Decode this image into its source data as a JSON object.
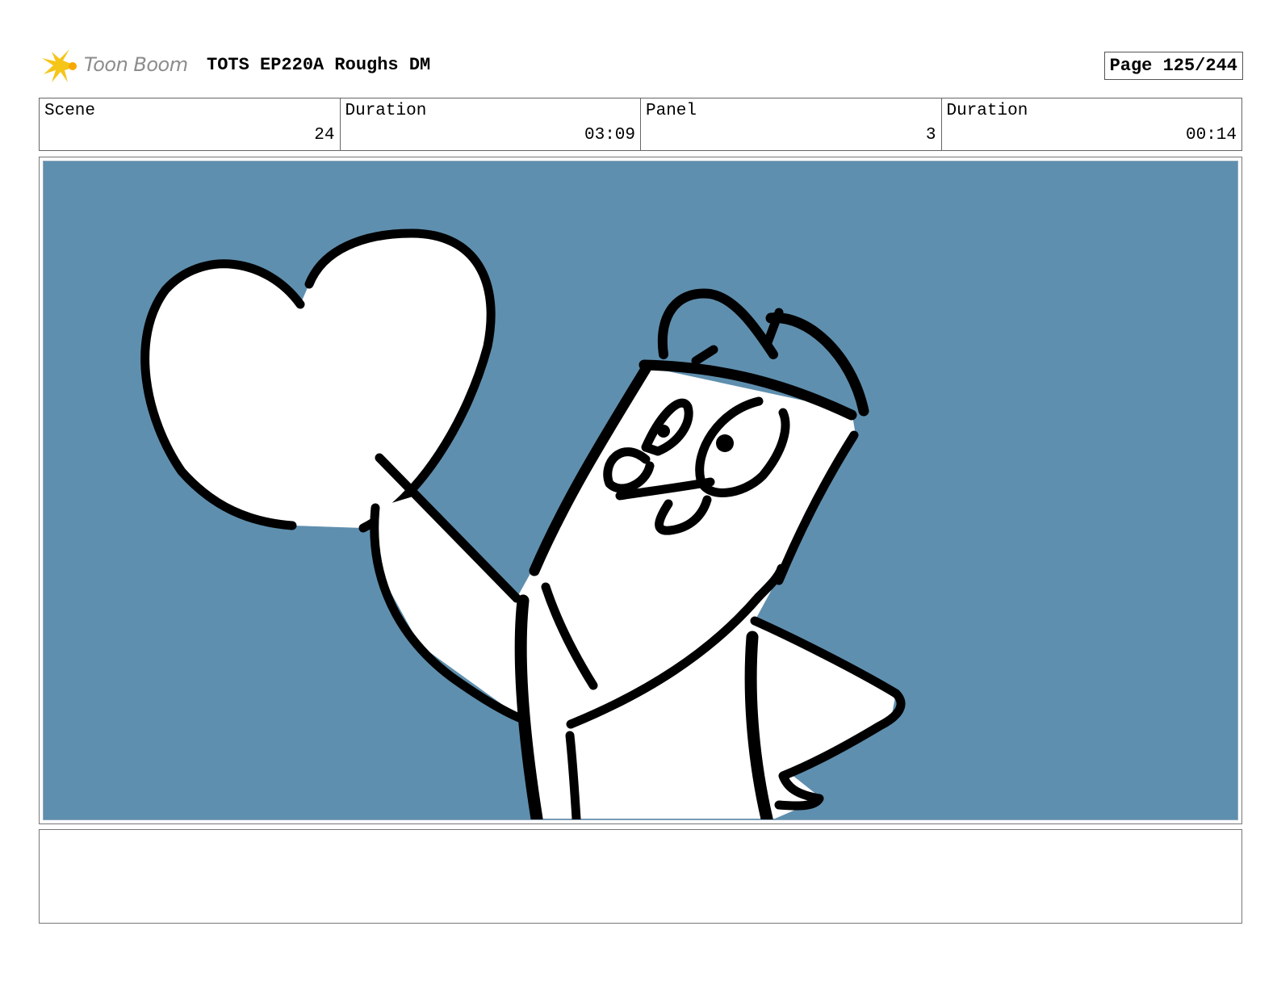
{
  "header": {
    "logo_text": "Toon Boom",
    "title": "TOTS EP220A Roughs DM",
    "page": "Page 125/244"
  },
  "info": {
    "scene_label": "Scene",
    "scene_value": "24",
    "scene_duration_label": "Duration",
    "scene_duration_value": "03:09",
    "panel_label": "Panel",
    "panel_value": "3",
    "panel_duration_label": "Duration",
    "panel_duration_value": "00:14"
  },
  "colors": {
    "background": "#5f8fae",
    "ink": "#000000",
    "logo_star": "#f5c518"
  },
  "notes": ""
}
